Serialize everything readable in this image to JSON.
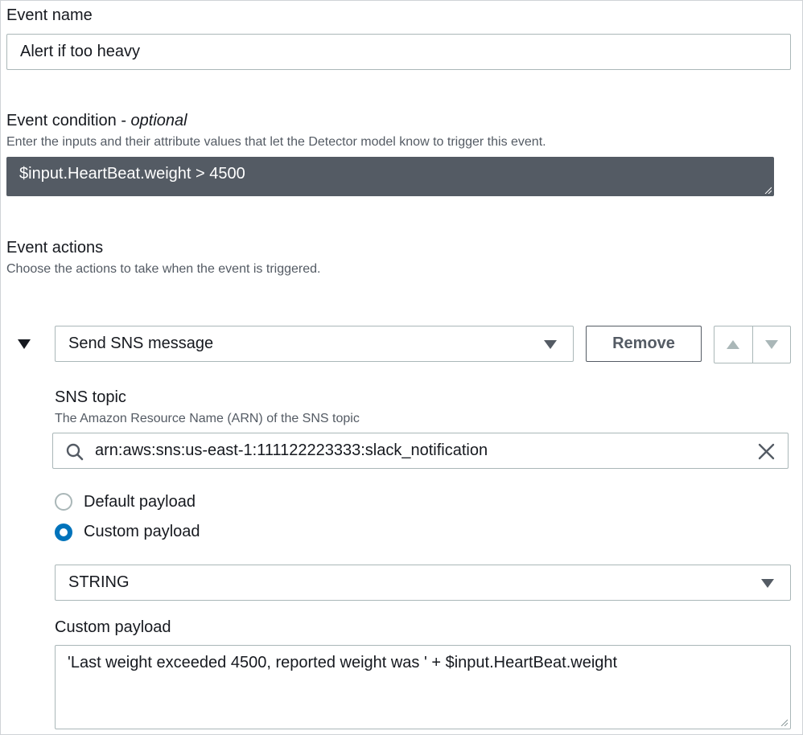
{
  "event_name": {
    "label": "Event name",
    "value": "Alert if too heavy"
  },
  "event_condition": {
    "label": "Event condition - ",
    "optional_label": "optional",
    "description": "Enter the inputs and their attribute values that let the Detector model know to trigger this event.",
    "value": "$input.HeartBeat.weight > 4500"
  },
  "event_actions": {
    "label": "Event actions",
    "description": "Choose the actions to take when the event is triggered.",
    "action": {
      "type_selected": "Send SNS message",
      "remove_label": "Remove",
      "sns_topic": {
        "label": "SNS topic",
        "description": "The Amazon Resource Name (ARN) of the SNS topic",
        "value": "arn:aws:sns:us-east-1:111122223333:slack_notification"
      },
      "payload_options": [
        {
          "label": "Default payload",
          "checked": false
        },
        {
          "label": "Custom payload",
          "checked": true
        }
      ],
      "payload_type_selected": "STRING",
      "custom_payload": {
        "label": "Custom payload",
        "value": "'Last weight exceeded 4500, reported weight was ' + $input.HeartBeat.weight"
      }
    }
  },
  "colors": {
    "primary": "#0073bb",
    "text": "#16191f",
    "secondary_text": "#545b64",
    "border": "#aab7b8",
    "code_background": "#545b64"
  }
}
